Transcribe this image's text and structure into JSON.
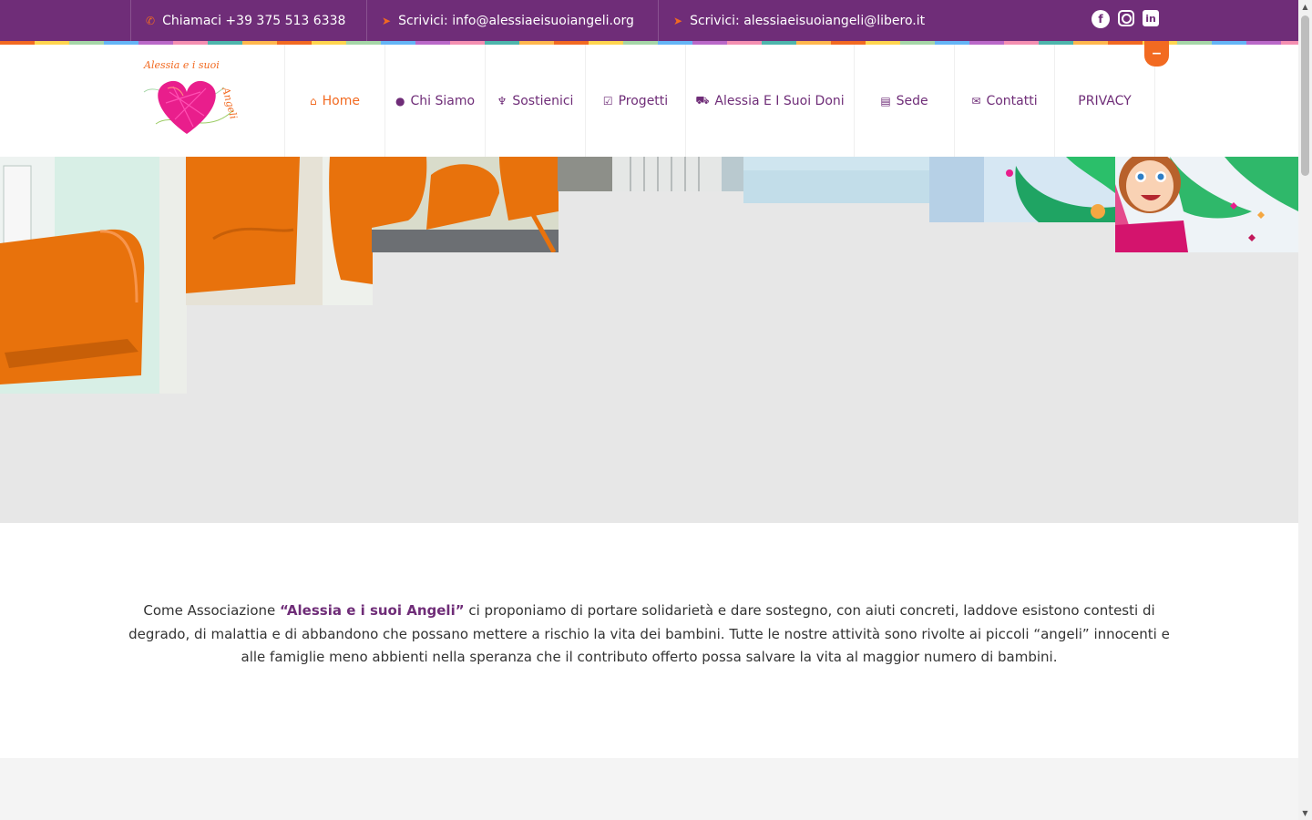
{
  "topbar": {
    "phone": {
      "icon": "phone-icon",
      "text": "Chiamaci +39 375 513 6338"
    },
    "email1": {
      "icon": "paper-plane-icon",
      "text": "Scrivici: info@alessiaeisuoiangeli.org"
    },
    "email2": {
      "icon": "paper-plane-icon",
      "text": "Scrivici: alessiaeisuoiangeli@libero.it"
    },
    "social": {
      "facebook": {
        "icon": "facebook-icon",
        "glyph": "f"
      },
      "instagram": {
        "icon": "instagram-icon"
      },
      "linkedin": {
        "icon": "linkedin-icon",
        "glyph": "in"
      }
    }
  },
  "logo": {
    "text_line1": "Alessia e i suoi",
    "text_line2": "Angeli"
  },
  "nav": {
    "items": [
      {
        "label": "Home",
        "icon": "home-icon",
        "glyph": "⌂",
        "active": true
      },
      {
        "label": "Chi Siamo",
        "icon": "user-icon",
        "glyph": "●",
        "active": false
      },
      {
        "label": "Sostienici",
        "icon": "torch-icon",
        "glyph": "♆",
        "active": false
      },
      {
        "label": "Progetti",
        "icon": "check-square-icon",
        "glyph": "☑",
        "active": false
      },
      {
        "label": "Alessia E I Suoi Doni",
        "icon": "cart-icon",
        "glyph": "⛟",
        "active": false
      },
      {
        "label": "Sede",
        "icon": "building-icon",
        "glyph": "▤",
        "active": false
      },
      {
        "label": "Contatti",
        "icon": "envelope-icon",
        "glyph": "✉",
        "active": false
      },
      {
        "label": "PRIVACY",
        "icon": "",
        "glyph": "",
        "active": false
      }
    ],
    "toggle_glyph": "−"
  },
  "intro": {
    "before": "Come Associazione ",
    "highlight": "“Alessia e i suoi Angeli”",
    "after": " ci proponiamo di portare solidarietà e dare sostegno, con aiuti concreti, laddove esistono contesti di degrado, di malattia e di abbandono che possano mettere a rischio la vita dei bambini. Tutte le nostre attività sono rivolte ai piccoli “angeli” innocenti e alle famiglie meno abbienti nella speranza che il contributo offerto possa salvare la vita al maggior numero di bambini."
  },
  "colors": {
    "brand_purple": "#6f2d78",
    "accent_orange": "#f26a21",
    "gallery_bg": "#e7e7e7"
  },
  "scrollbar": {
    "up_glyph": "▲",
    "down_glyph": "▼"
  }
}
